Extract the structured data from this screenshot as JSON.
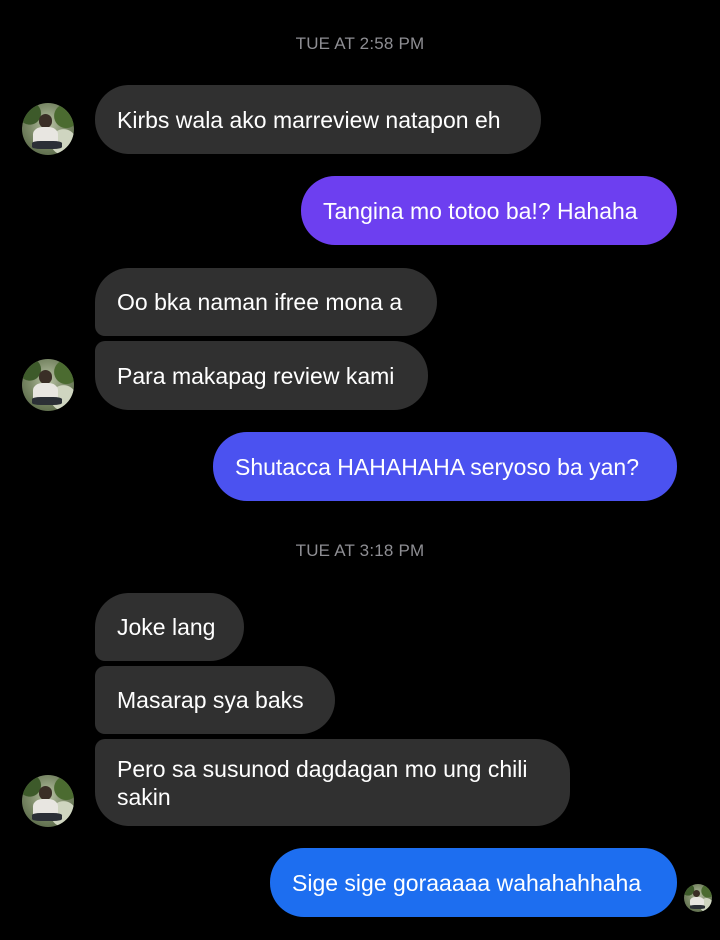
{
  "colors": {
    "background": "#000000",
    "incoming_bubble": "#303030",
    "outgoing_gradient_top": "#6a3df0",
    "outgoing_gradient_bottom": "#1f6ff0",
    "timestamp_text": "#8e8e93",
    "bubble_text": "#ffffff"
  },
  "conversation": {
    "timestamps": [
      "TUE AT 2:58 PM",
      "TUE AT 3:18 PM"
    ],
    "messages": [
      {
        "direction": "incoming",
        "text": "Kirbs wala ako marreview natapon eh"
      },
      {
        "direction": "outgoing",
        "text": "Tangina mo totoo ba!? Hahaha"
      },
      {
        "direction": "incoming",
        "text": "Oo bka naman ifree mona a"
      },
      {
        "direction": "incoming",
        "text": "Para makapag review kami"
      },
      {
        "direction": "outgoing",
        "text": "Shutacca HAHAHAHA seryoso ba yan?"
      },
      {
        "direction": "incoming",
        "text": "Joke lang"
      },
      {
        "direction": "incoming",
        "text": "Masarap sya baks"
      },
      {
        "direction": "incoming",
        "text": "Pero sa susunod dagdagan mo ung chili sakin"
      },
      {
        "direction": "outgoing",
        "text": "Sige sige goraaaaa wahahahhaha"
      }
    ]
  }
}
